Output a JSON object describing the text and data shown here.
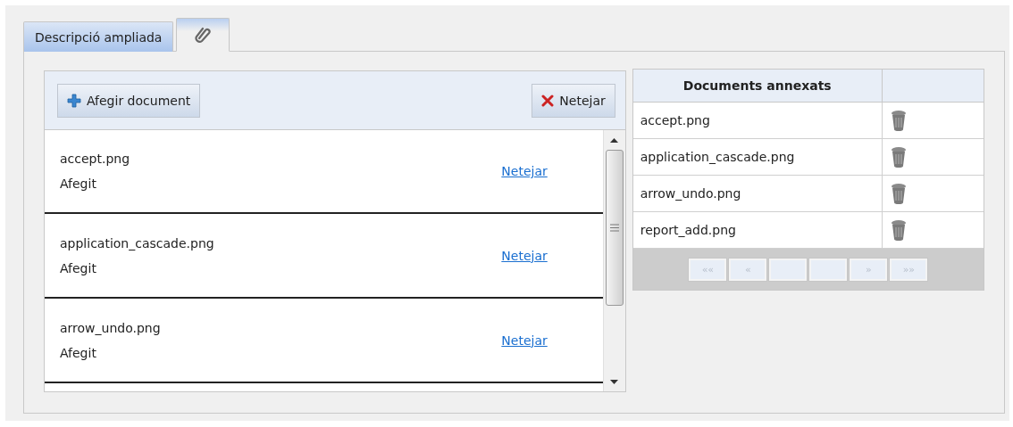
{
  "tabs": [
    {
      "label": "Descripció ampliada",
      "kind": "text",
      "selected": false
    },
    {
      "kind": "paperclip",
      "selected": true
    }
  ],
  "uploader": {
    "toolbar": [
      {
        "label": "Afegir document",
        "kind": "add"
      },
      {
        "label": "Netejar",
        "kind": "clear"
      }
    ],
    "files": [
      {
        "name": "accept.png",
        "status": "Afegit",
        "action": "Netejar"
      },
      {
        "name": "application_cascade.png",
        "status": "Afegit",
        "action": "Netejar"
      },
      {
        "name": "arrow_undo.png",
        "status": "Afegit",
        "action": "Netejar"
      }
    ]
  },
  "documents": {
    "columns": [
      "Documents annexats"
    ],
    "rows": [
      {
        "name": "accept.png"
      },
      {
        "name": "application_cascade.png"
      },
      {
        "name": "arrow_undo.png"
      },
      {
        "name": "report_add.png"
      }
    ],
    "pager": [
      {
        "label": "««",
        "disabled": true
      },
      {
        "label": "«",
        "disabled": true
      },
      {
        "disabled": true
      },
      {
        "disabled": true
      },
      {
        "label": "»",
        "disabled": true
      },
      {
        "label": "»»",
        "disabled": true
      }
    ]
  }
}
